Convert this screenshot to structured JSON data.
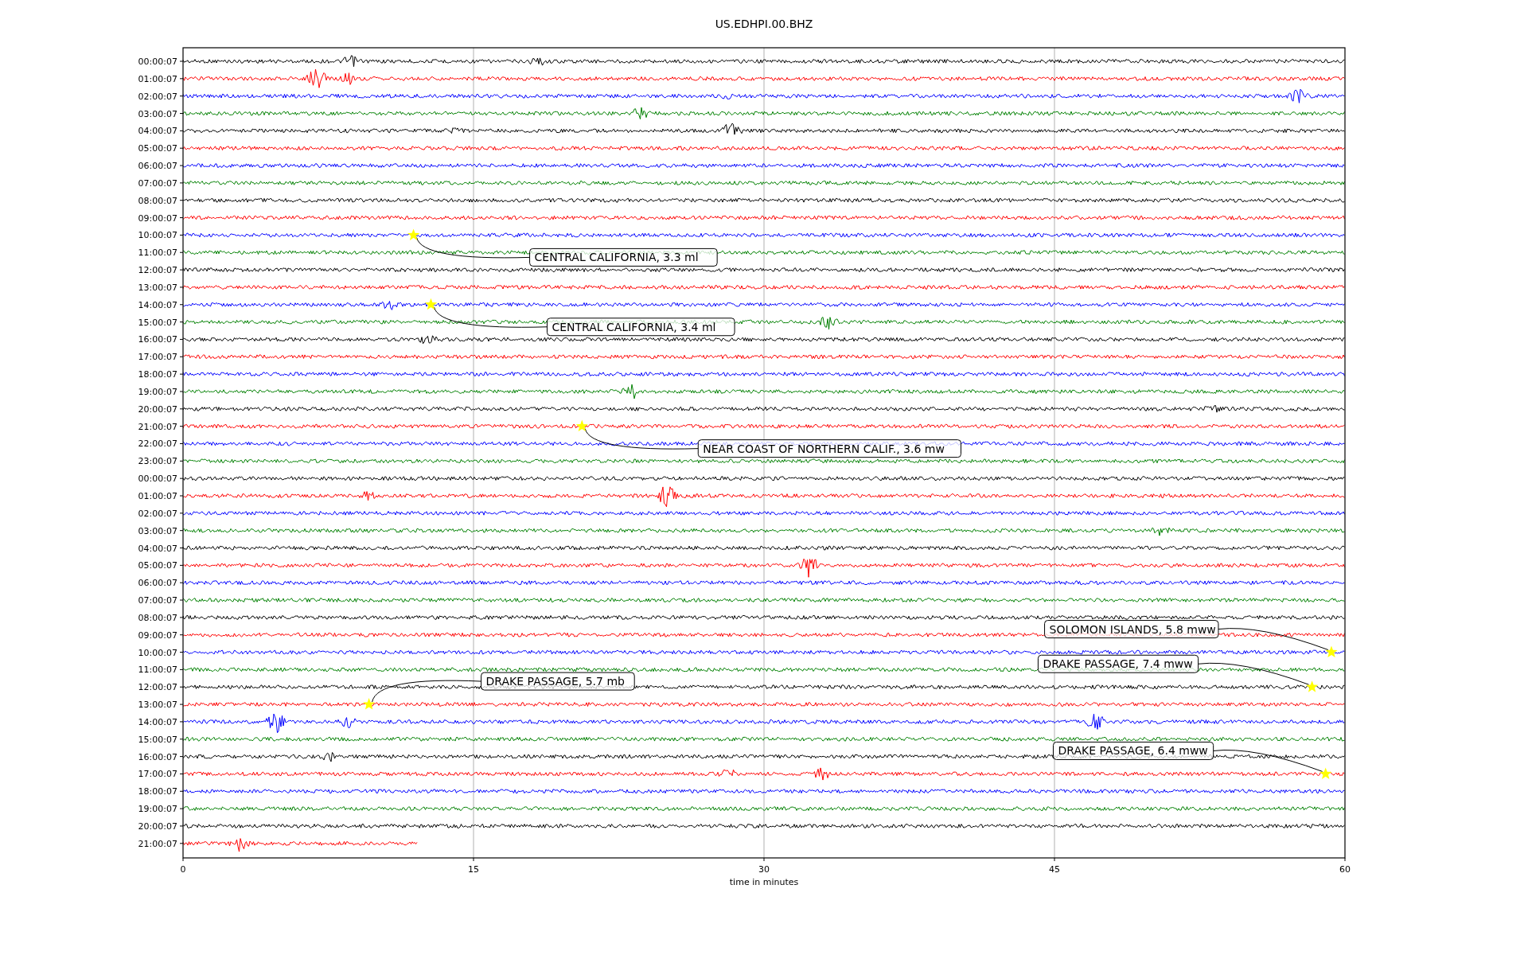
{
  "title": "US.EDHPI.00.BHZ",
  "y_labels": [
    "00:00:07",
    "01:00:07",
    "02:00:07",
    "03:00:07",
    "04:00:07",
    "05:00:07",
    "06:00:07",
    "07:00:07",
    "08:00:07",
    "09:00:07",
    "10:00:07",
    "11:00:07",
    "12:00:07",
    "13:00:07",
    "14:00:07",
    "15:00:07",
    "16:00:07",
    "17:00:07",
    "18:00:07",
    "19:00:07",
    "20:00:07",
    "21:00:07",
    "22:00:07",
    "23:00:07",
    "00:00:07",
    "01:00:07",
    "02:00:07",
    "03:00:07",
    "04:00:07",
    "05:00:07",
    "06:00:07",
    "07:00:07",
    "08:00:07",
    "09:00:07",
    "10:00:07",
    "11:00:07",
    "12:00:07",
    "13:00:07",
    "14:00:07",
    "15:00:07",
    "16:00:07",
    "17:00:07",
    "18:00:07",
    "19:00:07",
    "20:00:07",
    "21:00:07"
  ],
  "x_ticks": [
    "0",
    "15",
    "30",
    "45",
    "60"
  ],
  "xlabel": "time in minutes",
  "events": [
    {
      "label": "CENTRAL CALIFORNIA, 3.3 ml"
    },
    {
      "label": "CENTRAL CALIFORNIA, 3.4 ml"
    },
    {
      "label": "NEAR COAST OF NORTHERN CALIF., 3.6 mw"
    },
    {
      "label": "SOLOMON ISLANDS, 5.8 mww"
    },
    {
      "label": "DRAKE PASSAGE, 7.4 mww"
    },
    {
      "label": "DRAKE PASSAGE, 5.7 mb"
    },
    {
      "label": "DRAKE PASSAGE, 6.4 mww"
    }
  ]
}
